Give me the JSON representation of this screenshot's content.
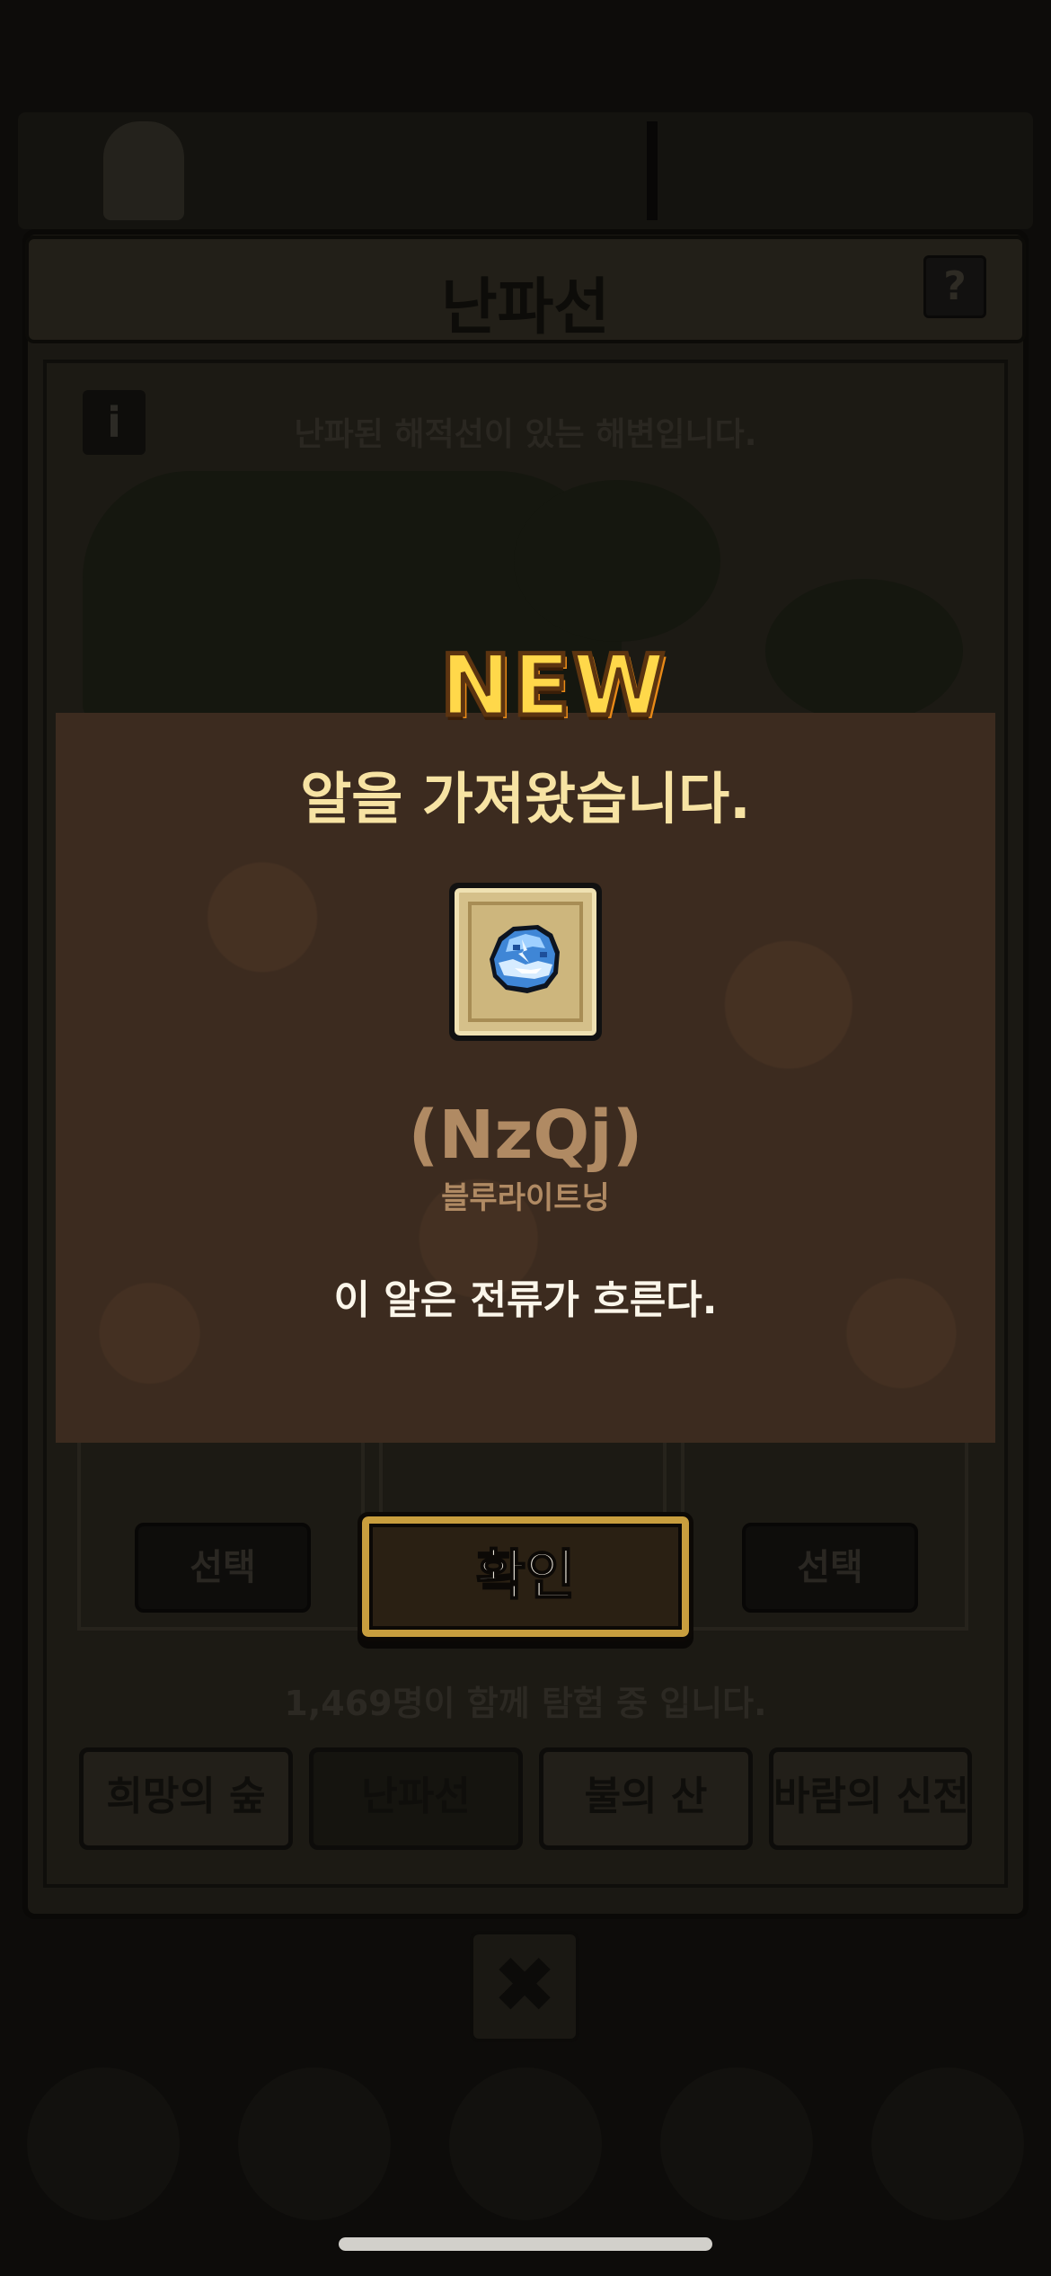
{
  "background": {
    "page_title": "난파선",
    "help_label": "?",
    "info_label": "i",
    "stage_description": "난파된 해적선이 있는 해변입니다.",
    "select_button_left": "선택",
    "select_button_right": "선택",
    "players_online": "1,469명이 함께 탐험 중 입니다.",
    "stage_tabs": [
      "희망의 숲",
      "난파선",
      "불의 산",
      "바람의 신전"
    ],
    "close_label": "✖"
  },
  "modal": {
    "badge": "NEW",
    "title": "알을 가져왔습니다.",
    "item_icon": "blue-lightning-egg-icon",
    "item_name": "(NzQj)",
    "item_subtitle": "블루라이트닝",
    "item_description": "이 알은 전류가 흐른다.",
    "confirm_label": "확인"
  },
  "colors": {
    "modal_bg": "#3c2b1f",
    "title_gold": "#f7e3a3",
    "item_name_tan": "#b08a63",
    "button_gold_border": "#c89e3e",
    "badge_yellow": "#ffd84a"
  }
}
